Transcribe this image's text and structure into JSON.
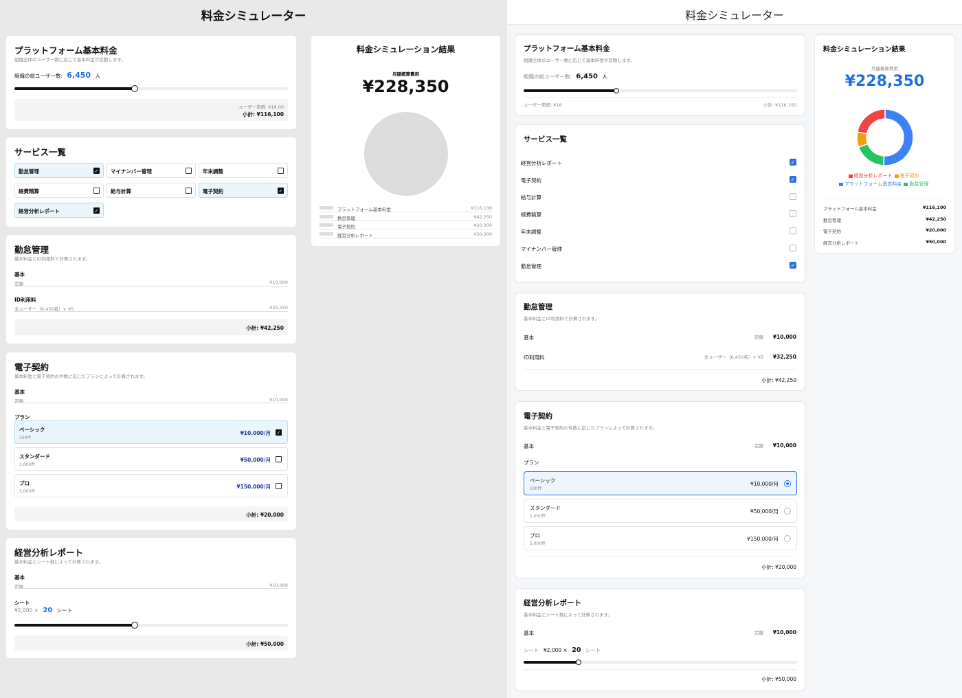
{
  "app_title": "料金シミュレーター",
  "platform": {
    "title": "プラットフォーム基本料金",
    "desc": "組織全体のユーザー数に応じて基本料金が変動します。",
    "users_label": "組織の総ユーザー数:",
    "users_value": "6,450",
    "users_unit": "人",
    "slider_fraction_left": 0.44,
    "slider_fraction_right": 0.34,
    "unit_price_left": "ユーザー単価: ¥18.00",
    "unit_price_right": "ユーザー単価: ¥18",
    "subtotal_left": "小計: ¥116,100",
    "subtotal_right": "小計: ¥116,100"
  },
  "services": {
    "title": "サービス一覧",
    "left_tiles": [
      {
        "label": "勤怠管理",
        "checked": true
      },
      {
        "label": "マイナンバー管理",
        "checked": false
      },
      {
        "label": "年末調整",
        "checked": false
      },
      {
        "label": "経費精算",
        "checked": false
      },
      {
        "label": "給与計算",
        "checked": false
      },
      {
        "label": "電子契約",
        "checked": true
      },
      {
        "label": "経営分析レポート",
        "checked": true
      }
    ],
    "right_list": [
      {
        "label": "経営分析レポート",
        "checked": true
      },
      {
        "label": "電子契約",
        "checked": true
      },
      {
        "label": "給与計算",
        "checked": false
      },
      {
        "label": "経費精算",
        "checked": false
      },
      {
        "label": "年末調整",
        "checked": false
      },
      {
        "label": "マイナンバー管理",
        "checked": false
      },
      {
        "label": "勤怠管理",
        "checked": true
      }
    ]
  },
  "attendance": {
    "title": "勤怠管理",
    "desc": "基本料金とID利用料で計算されます。",
    "base_label": "基本",
    "base_note": "定額",
    "base_price": "¥10,000",
    "id_label": "ID利用料",
    "id_note": "全ユーザー（6,450名）× ¥5",
    "id_price": "¥32,250",
    "subtotal": "小計: ¥42,250"
  },
  "contract": {
    "title": "電子契約",
    "desc": "基本料金と電子契約の件数に応じたプランによって計算されます。",
    "base_label": "基本",
    "base_note": "定額",
    "base_price": "¥10,000",
    "plan_label": "プラン",
    "plans": [
      {
        "name": "ベーシック",
        "count": "100件",
        "price": "¥10,000/月",
        "selected": true
      },
      {
        "name": "スタンダード",
        "count": "1,000件",
        "price": "¥50,000/月",
        "selected": false
      },
      {
        "name": "プロ",
        "count": "5,000件",
        "price": "¥150,000/月",
        "selected": false
      }
    ],
    "subtotal": "小計: ¥20,000"
  },
  "report": {
    "title": "経営分析レポート",
    "desc": "基本料金とシート数によって計算されます。",
    "base_label": "基本",
    "base_note": "定額",
    "base_price": "¥10,000",
    "seat_label": "シート",
    "seat_unit_price": "¥2,000 ×",
    "seat_value": "20",
    "seat_unit": "シート",
    "slider_fraction_left": 0.44,
    "slider_fraction_right": 0.2,
    "subtotal": "小計: ¥50,000"
  },
  "result": {
    "title": "料金シミュレーション結果",
    "monthly_label": "月額概算費用",
    "monthly_label_right": "月額概算費用",
    "total": "¥228,350",
    "legend_right": [
      {
        "label": "経営分析レポート",
        "color": "#ef4444"
      },
      {
        "label": "電子契約",
        "color": "#f59e0b"
      },
      {
        "label": "プラットフォーム基本料金",
        "color": "#3b82f6"
      },
      {
        "label": "勤怠管理",
        "color": "#22c55e"
      }
    ],
    "breakdown": [
      {
        "label": "プラットフォーム基本料金",
        "value": "¥116,100"
      },
      {
        "label": "勤怠管理",
        "value": "¥42,250"
      },
      {
        "label": "電子契約",
        "value": "¥20,000"
      },
      {
        "label": "経営分析レポート",
        "value": "¥50,000"
      }
    ]
  },
  "chart_data": {
    "type": "pie",
    "categories": [
      "プラットフォーム基本料金",
      "勤怠管理",
      "電子契約",
      "経営分析レポート"
    ],
    "values": [
      116100,
      42250,
      20000,
      50000
    ],
    "colors": [
      "#3b82f6",
      "#22c55e",
      "#f59e0b",
      "#ef4444"
    ],
    "legend": "bottom"
  }
}
